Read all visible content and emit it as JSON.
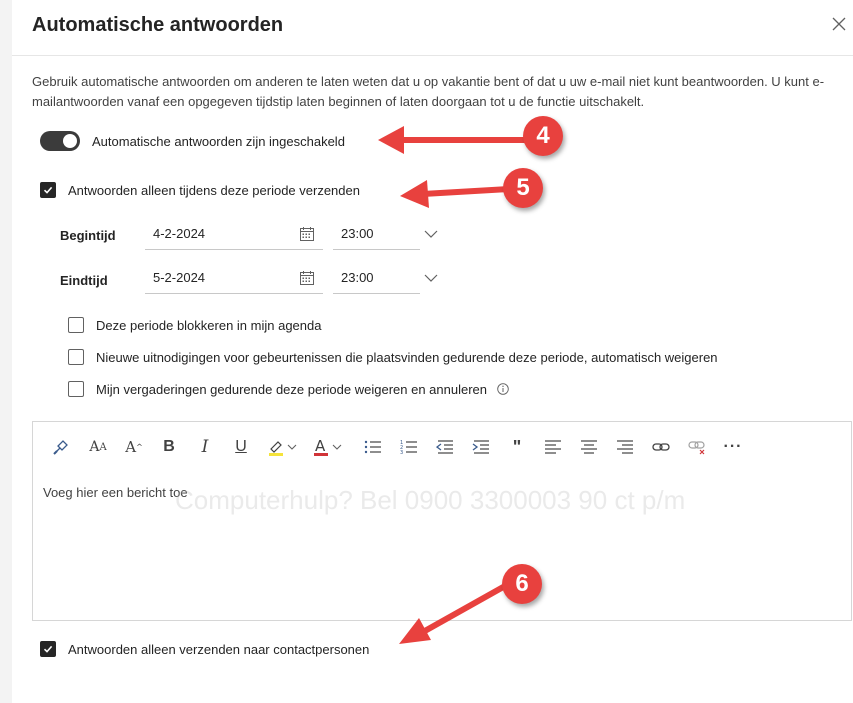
{
  "dialog": {
    "title": "Automatische antwoorden",
    "description": "Gebruik automatische antwoorden om anderen te laten weten dat u op vakantie bent of dat u uw e-mail niet kunt beantwoorden. U kunt e-mailantwoorden vanaf een opgegeven tijdstip laten beginnen of laten doorgaan tot u de functie uitschakelt."
  },
  "toggle": {
    "label": "Automatische antwoorden zijn ingeschakeld",
    "on": true
  },
  "period_checkbox": {
    "label": "Antwoorden alleen tijdens deze periode verzenden",
    "checked": true
  },
  "start": {
    "label": "Begintijd",
    "date": "4-2-2024",
    "time": "23:00"
  },
  "end": {
    "label": "Eindtijd",
    "date": "5-2-2024",
    "time": "23:00"
  },
  "options": [
    {
      "label": "Deze periode blokkeren in mijn agenda",
      "checked": false
    },
    {
      "label": "Nieuwe uitnodigingen voor gebeurtenissen die plaatsvinden gedurende deze periode, automatisch weigeren",
      "checked": false
    },
    {
      "label": "Mijn vergaderingen gedurende deze periode weigeren en annuleren",
      "checked": false
    }
  ],
  "editor": {
    "placeholder": "Voeg hier een bericht toe",
    "toolbar": [
      "format-painter-icon",
      "font-size-icon",
      "superscript-size-icon",
      "bold-icon",
      "italic-icon",
      "underline-icon",
      "highlight-icon",
      "font-color-icon",
      "bullets-icon",
      "numbering-icon",
      "decrease-indent-icon",
      "increase-indent-icon",
      "quote-icon",
      "align-left-icon",
      "align-center-icon",
      "align-right-icon",
      "link-icon",
      "unlink-icon",
      "more-icon"
    ]
  },
  "contacts_checkbox": {
    "label": "Antwoorden alleen verzenden naar contactpersonen",
    "checked": true
  },
  "annotations": {
    "badge_4": "4",
    "badge_5": "5",
    "badge_6": "6"
  },
  "watermark": "Computerhulp? Bel 0900 3300003 90 ct p/m",
  "colors": {
    "accent": "#e8413e",
    "toggle_on": "#3b3b3b",
    "highlight": "#f5e33a",
    "font_color": "#d13438"
  }
}
